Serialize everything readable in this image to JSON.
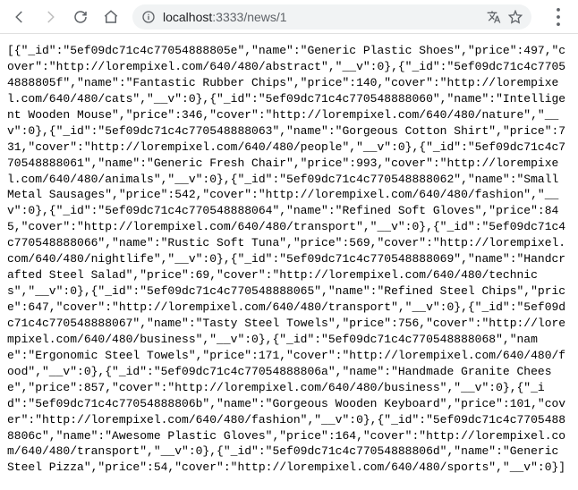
{
  "url": {
    "host": "localhost",
    "port": ":3333",
    "path": "/news/1"
  },
  "items": [
    {
      "_id": "5ef09dc71c4c77054888805e",
      "name": "Generic Plastic Shoes",
      "price": 497,
      "cover": "http://lorempixel.com/640/480/abstract",
      "__v": 0
    },
    {
      "_id": "5ef09dc71c4c77054888805f",
      "name": "Fantastic Rubber Chips",
      "price": 140,
      "cover": "http://lorempixel.com/640/480/cats",
      "__v": 0
    },
    {
      "_id": "5ef09dc71c4c770548888060",
      "name": "Intelligent Wooden Mouse",
      "price": 346,
      "cover": "http://lorempixel.com/640/480/nature",
      "__v": 0
    },
    {
      "_id": "5ef09dc71c4c770548888063",
      "name": "Gorgeous Cotton Shirt",
      "price": 731,
      "cover": "http://lorempixel.com/640/480/people",
      "__v": 0
    },
    {
      "_id": "5ef09dc71c4c770548888061",
      "name": "Generic Fresh Chair",
      "price": 993,
      "cover": "http://lorempixel.com/640/480/animals",
      "__v": 0
    },
    {
      "_id": "5ef09dc71c4c770548888062",
      "name": "Small Metal Sausages",
      "price": 542,
      "cover": "http://lorempixel.com/640/480/fashion",
      "__v": 0
    },
    {
      "_id": "5ef09dc71c4c770548888064",
      "name": "Refined Soft Gloves",
      "price": 845,
      "cover": "http://lorempixel.com/640/480/transport",
      "__v": 0
    },
    {
      "_id": "5ef09dc71c4c770548888066",
      "name": "Rustic Soft Tuna",
      "price": 569,
      "cover": "http://lorempixel.com/640/480/nightlife",
      "__v": 0
    },
    {
      "_id": "5ef09dc71c4c770548888069",
      "name": "Handcrafted Steel Salad",
      "price": 69,
      "cover": "http://lorempixel.com/640/480/technics",
      "__v": 0
    },
    {
      "_id": "5ef09dc71c4c770548888065",
      "name": "Refined Steel Chips",
      "price": 647,
      "cover": "http://lorempixel.com/640/480/transport",
      "__v": 0
    },
    {
      "_id": "5ef09dc71c4c770548888067",
      "name": "Tasty Steel Towels",
      "price": 756,
      "cover": "http://lorempixel.com/640/480/business",
      "__v": 0
    },
    {
      "_id": "5ef09dc71c4c770548888068",
      "name": "Ergonomic Steel Towels",
      "price": 171,
      "cover": "http://lorempixel.com/640/480/food",
      "__v": 0
    },
    {
      "_id": "5ef09dc71c4c77054888806a",
      "name": "Handmade Granite Cheese",
      "price": 857,
      "cover": "http://lorempixel.com/640/480/business",
      "__v": 0
    },
    {
      "_id": "5ef09dc71c4c77054888806b",
      "name": "Gorgeous Wooden Keyboard",
      "price": 101,
      "cover": "http://lorempixel.com/640/480/fashion",
      "__v": 0
    },
    {
      "_id": "5ef09dc71c4c77054888806c",
      "name": "Awesome Plastic Gloves",
      "price": 164,
      "cover": "http://lorempixel.com/640/480/transport",
      "__v": 0
    },
    {
      "_id": "5ef09dc71c4c77054888806d",
      "name": "Generic Steel Pizza",
      "price": 54,
      "cover": "http://lorempixel.com/640/480/sports",
      "__v": 0
    }
  ]
}
